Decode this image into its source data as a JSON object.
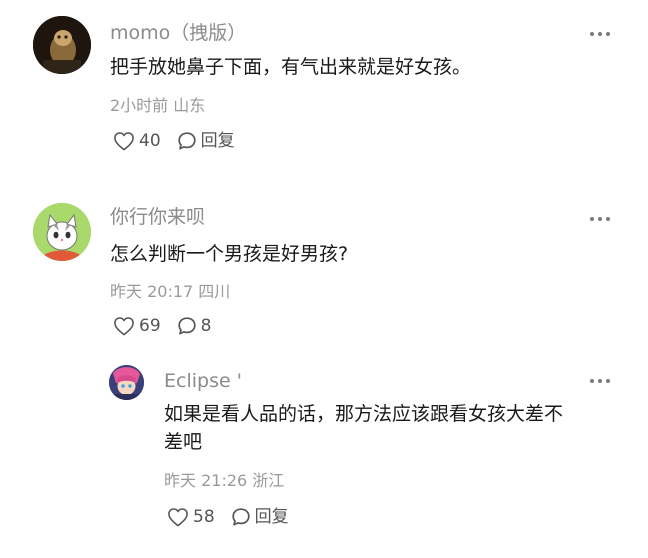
{
  "comments": [
    {
      "author": "momo（拽版）",
      "text": "把手放她鼻子下面，有气出来就是好女孩。",
      "meta": "2小时前 山东",
      "likes": "40",
      "reply_label": "回复"
    },
    {
      "author": "你行你来呗",
      "text": "怎么判断一个男孩是好男孩?",
      "meta": "昨天 20:17 四川",
      "likes": "69",
      "reply_count": "8"
    }
  ],
  "reply": {
    "author": "Eclipse '",
    "text_line1": "如果是看人品的话，那方法应该跟看女孩大差不",
    "text_line2": "差吧",
    "meta": "昨天 21:26 浙江",
    "likes": "58",
    "reply_label": "回复"
  },
  "colors": {
    "author": "#8b8b8b",
    "text": "#1a1a1a",
    "meta": "#9a9a9a",
    "action": "#555555"
  },
  "icons": [
    "heart-icon",
    "comment-bubble-icon",
    "more-dots-icon"
  ]
}
